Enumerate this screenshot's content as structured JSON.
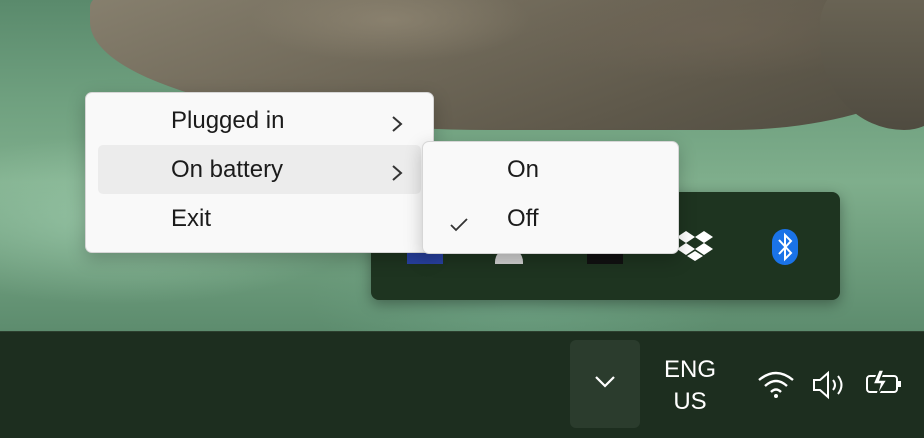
{
  "context_menu": {
    "items": [
      {
        "label": "Plugged in"
      },
      {
        "label": "On battery"
      },
      {
        "label": "Exit"
      }
    ]
  },
  "submenu": {
    "items": [
      {
        "label": "On",
        "checked": false
      },
      {
        "label": "Off",
        "checked": true
      }
    ]
  },
  "taskbar": {
    "language": {
      "line1": "ENG",
      "line2": "US"
    },
    "icons": [
      "chevron-up-icon",
      "wifi-icon",
      "speaker-icon",
      "battery-charging-icon"
    ]
  },
  "tray_overflow": {
    "icons": [
      "app-icon",
      "app-icon",
      "app-icon",
      "dropbox-icon",
      "bluetooth-icon"
    ]
  },
  "colors": {
    "taskbar": "#1d2e1f",
    "flyout": "#1e3420",
    "menu_bg": "#f9f9f9",
    "bluetooth": "#1a73e8"
  }
}
